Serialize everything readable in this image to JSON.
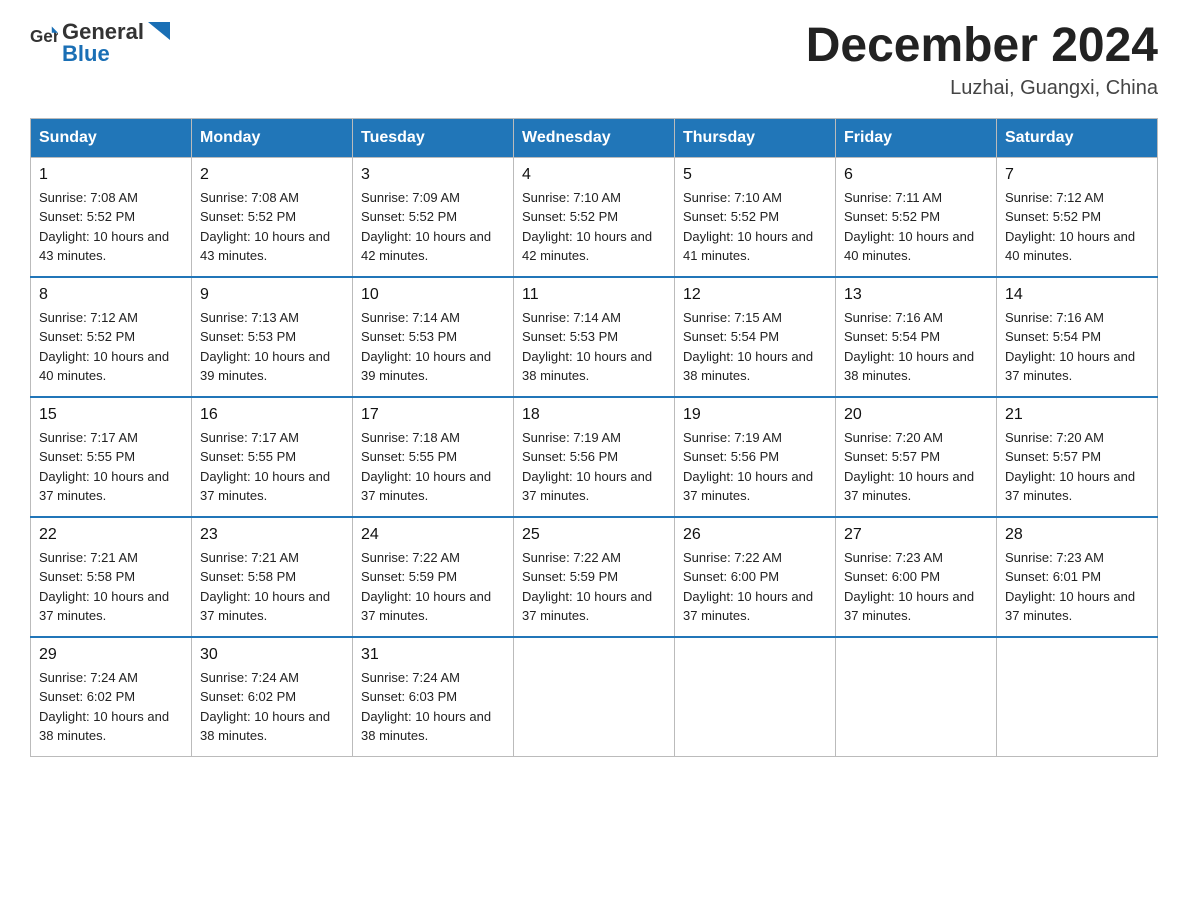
{
  "logo": {
    "text_general": "General",
    "text_blue": "Blue"
  },
  "title": "December 2024",
  "subtitle": "Luzhai, Guangxi, China",
  "weekdays": [
    "Sunday",
    "Monday",
    "Tuesday",
    "Wednesday",
    "Thursday",
    "Friday",
    "Saturday"
  ],
  "weeks": [
    [
      {
        "day": "1",
        "sunrise": "7:08 AM",
        "sunset": "5:52 PM",
        "daylight": "10 hours and 43 minutes."
      },
      {
        "day": "2",
        "sunrise": "7:08 AM",
        "sunset": "5:52 PM",
        "daylight": "10 hours and 43 minutes."
      },
      {
        "day": "3",
        "sunrise": "7:09 AM",
        "sunset": "5:52 PM",
        "daylight": "10 hours and 42 minutes."
      },
      {
        "day": "4",
        "sunrise": "7:10 AM",
        "sunset": "5:52 PM",
        "daylight": "10 hours and 42 minutes."
      },
      {
        "day": "5",
        "sunrise": "7:10 AM",
        "sunset": "5:52 PM",
        "daylight": "10 hours and 41 minutes."
      },
      {
        "day": "6",
        "sunrise": "7:11 AM",
        "sunset": "5:52 PM",
        "daylight": "10 hours and 40 minutes."
      },
      {
        "day": "7",
        "sunrise": "7:12 AM",
        "sunset": "5:52 PM",
        "daylight": "10 hours and 40 minutes."
      }
    ],
    [
      {
        "day": "8",
        "sunrise": "7:12 AM",
        "sunset": "5:52 PM",
        "daylight": "10 hours and 40 minutes."
      },
      {
        "day": "9",
        "sunrise": "7:13 AM",
        "sunset": "5:53 PM",
        "daylight": "10 hours and 39 minutes."
      },
      {
        "day": "10",
        "sunrise": "7:14 AM",
        "sunset": "5:53 PM",
        "daylight": "10 hours and 39 minutes."
      },
      {
        "day": "11",
        "sunrise": "7:14 AM",
        "sunset": "5:53 PM",
        "daylight": "10 hours and 38 minutes."
      },
      {
        "day": "12",
        "sunrise": "7:15 AM",
        "sunset": "5:54 PM",
        "daylight": "10 hours and 38 minutes."
      },
      {
        "day": "13",
        "sunrise": "7:16 AM",
        "sunset": "5:54 PM",
        "daylight": "10 hours and 38 minutes."
      },
      {
        "day": "14",
        "sunrise": "7:16 AM",
        "sunset": "5:54 PM",
        "daylight": "10 hours and 37 minutes."
      }
    ],
    [
      {
        "day": "15",
        "sunrise": "7:17 AM",
        "sunset": "5:55 PM",
        "daylight": "10 hours and 37 minutes."
      },
      {
        "day": "16",
        "sunrise": "7:17 AM",
        "sunset": "5:55 PM",
        "daylight": "10 hours and 37 minutes."
      },
      {
        "day": "17",
        "sunrise": "7:18 AM",
        "sunset": "5:55 PM",
        "daylight": "10 hours and 37 minutes."
      },
      {
        "day": "18",
        "sunrise": "7:19 AM",
        "sunset": "5:56 PM",
        "daylight": "10 hours and 37 minutes."
      },
      {
        "day": "19",
        "sunrise": "7:19 AM",
        "sunset": "5:56 PM",
        "daylight": "10 hours and 37 minutes."
      },
      {
        "day": "20",
        "sunrise": "7:20 AM",
        "sunset": "5:57 PM",
        "daylight": "10 hours and 37 minutes."
      },
      {
        "day": "21",
        "sunrise": "7:20 AM",
        "sunset": "5:57 PM",
        "daylight": "10 hours and 37 minutes."
      }
    ],
    [
      {
        "day": "22",
        "sunrise": "7:21 AM",
        "sunset": "5:58 PM",
        "daylight": "10 hours and 37 minutes."
      },
      {
        "day": "23",
        "sunrise": "7:21 AM",
        "sunset": "5:58 PM",
        "daylight": "10 hours and 37 minutes."
      },
      {
        "day": "24",
        "sunrise": "7:22 AM",
        "sunset": "5:59 PM",
        "daylight": "10 hours and 37 minutes."
      },
      {
        "day": "25",
        "sunrise": "7:22 AM",
        "sunset": "5:59 PM",
        "daylight": "10 hours and 37 minutes."
      },
      {
        "day": "26",
        "sunrise": "7:22 AM",
        "sunset": "6:00 PM",
        "daylight": "10 hours and 37 minutes."
      },
      {
        "day": "27",
        "sunrise": "7:23 AM",
        "sunset": "6:00 PM",
        "daylight": "10 hours and 37 minutes."
      },
      {
        "day": "28",
        "sunrise": "7:23 AM",
        "sunset": "6:01 PM",
        "daylight": "10 hours and 37 minutes."
      }
    ],
    [
      {
        "day": "29",
        "sunrise": "7:24 AM",
        "sunset": "6:02 PM",
        "daylight": "10 hours and 38 minutes."
      },
      {
        "day": "30",
        "sunrise": "7:24 AM",
        "sunset": "6:02 PM",
        "daylight": "10 hours and 38 minutes."
      },
      {
        "day": "31",
        "sunrise": "7:24 AM",
        "sunset": "6:03 PM",
        "daylight": "10 hours and 38 minutes."
      },
      null,
      null,
      null,
      null
    ]
  ]
}
